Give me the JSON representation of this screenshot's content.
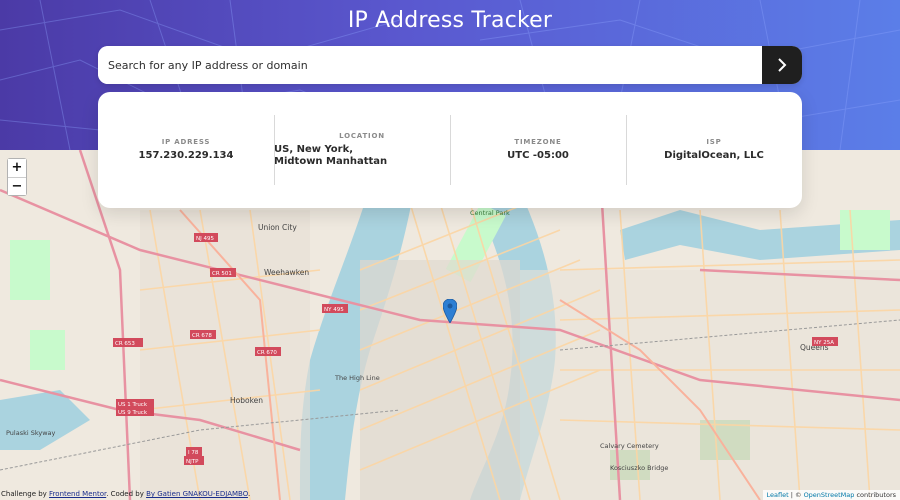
{
  "page": {
    "title": "IP Address Tracker"
  },
  "search": {
    "placeholder": "Search for any IP address or domain",
    "button_icon": "chevron-right-icon"
  },
  "info": [
    {
      "label": "IP ADRESS",
      "value": "157.230.229.134"
    },
    {
      "label": "LOCATION",
      "value": "US, New York, Midtown Manhattan"
    },
    {
      "label": "TIMEZONE",
      "value": "UTC -05:00"
    },
    {
      "label": "ISP",
      "value": "DigitalOcean, LLC"
    }
  ],
  "map": {
    "zoom_in": "+",
    "zoom_out": "−",
    "labels": [
      "Union City",
      "Weehawken",
      "Hoboken",
      "Central Park",
      "The High Line",
      "Queens",
      "Kosciuszko Bridge",
      "Calvary Cemetery",
      "Pulaski Skyway",
      "CR 501",
      "CR 678",
      "CR 670",
      "CR 653",
      "NY 495",
      "NJ 495",
      "NY 25A",
      "US 1 Truck",
      "US 9 Truck",
      "I 78",
      "NJTP"
    ],
    "attribution": {
      "leaflet": "Leaflet",
      "sep": " | © ",
      "osm": "OpenStreetMap",
      "suffix": " contributors"
    }
  },
  "credit": {
    "prefix": "Challenge by ",
    "fm": "Frontend Mentor",
    "mid": ". Coded by ",
    "author": "By Gatien GNAKOU-EDJAMBO",
    "end": "."
  },
  "colors": {
    "accent": "#1f1f1f",
    "header_start": "#4b3aa6",
    "header_end": "#5b7ee8",
    "pin": "#2d7fd3"
  }
}
